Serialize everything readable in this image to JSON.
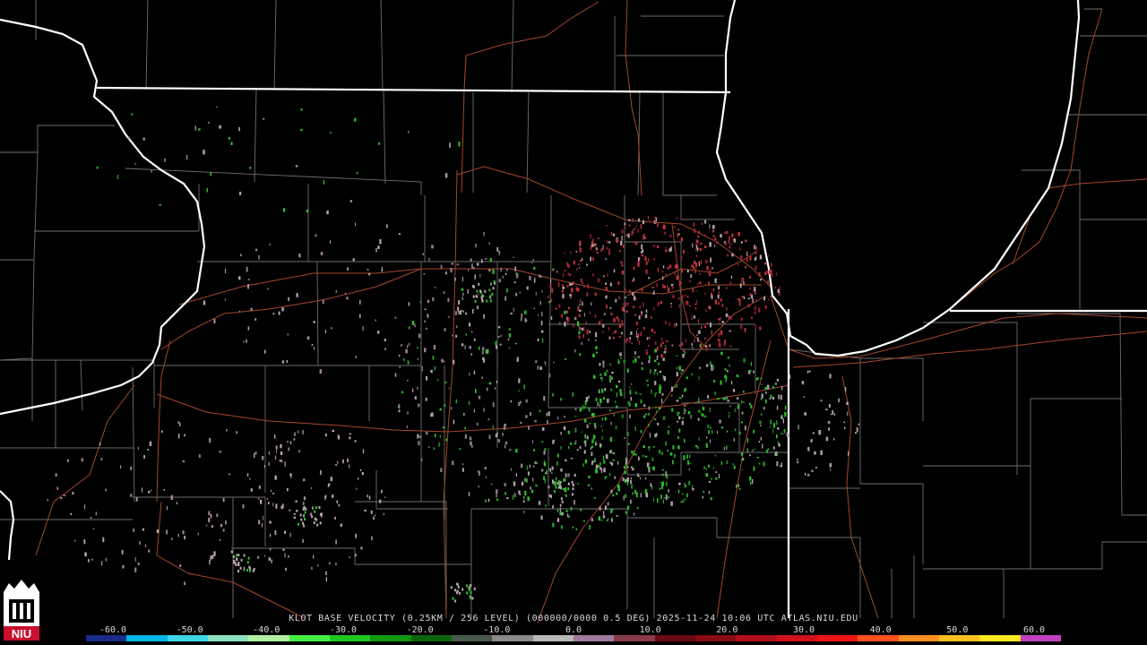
{
  "product": {
    "caption": "KLOT BASE VELOCITY (0.25KM / 256 LEVEL) (000000/0000 0.5 DEG) 2025-11-24 10:06 UTC  ATLAS.NIU.EDU"
  },
  "scale": {
    "ticks": [
      "-60.0",
      "-50.0",
      "-40.0",
      "-30.0",
      "-20.0",
      "-10.0",
      "0.0",
      "10.0",
      "20.0",
      "30.0",
      "40.0",
      "50.0",
      "60.0"
    ],
    "colors": [
      "#1a2a8a",
      "#00b7e6",
      "#3fd6e8",
      "#8de0c0",
      "#b0f0a0",
      "#44ee44",
      "#1fc81f",
      "#119911",
      "#0b660b",
      "#4a5a4a",
      "#8a8a8a",
      "#b8b8b8",
      "#a07a9a",
      "#8a3a4a",
      "#6a0a14",
      "#8a0c12",
      "#b0101a",
      "#d0121c",
      "#ee1414",
      "#ff5020",
      "#ff9020",
      "#ffc020",
      "#ffe820",
      "#c040c0"
    ]
  },
  "logo": {
    "text": "NIU",
    "color": "#c8102e"
  },
  "colors": {
    "background": "#000000",
    "state_border": "#ffffff",
    "county_border": "#6e6e6e",
    "highway": "#a4472c",
    "inbound_velocity": "#2fbf2f",
    "outbound_velocity": "#c0303a",
    "near_zero_velocity": "#b0a0a8"
  }
}
